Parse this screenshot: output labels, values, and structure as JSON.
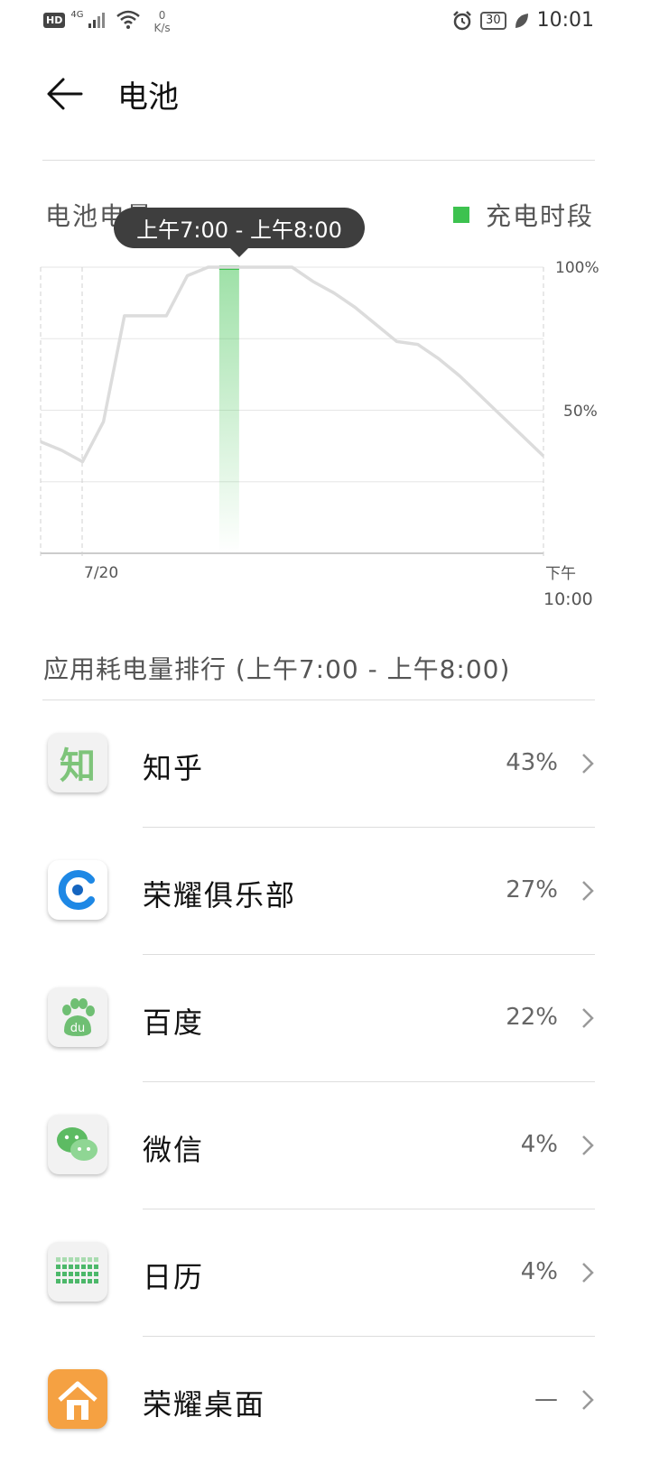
{
  "status_bar": {
    "hd": "HD",
    "network": "4G",
    "speed_value": "0",
    "speed_unit": "K/s",
    "battery": "30",
    "time": "10:01"
  },
  "header": {
    "title": "电池"
  },
  "chart": {
    "label": "电池电量",
    "legend_label": "充电时段",
    "tooltip": "上午7:00 - 上午8:00",
    "date_label": "7/20",
    "end_label_line1": "下午",
    "end_label_line2": "10:00",
    "accent_color": "#3dc24f"
  },
  "chart_data": {
    "type": "line",
    "title": "电池电量",
    "x_start": "7/20",
    "x_end": "下午10:00",
    "ylim": [
      0,
      100
    ],
    "y_ticks": [
      "100%",
      "50%"
    ],
    "highlight": "上午7:00 - 上午8:00",
    "series": [
      {
        "x": [
          0,
          1,
          2,
          3,
          4,
          5,
          6,
          7,
          8,
          9,
          10,
          11,
          12,
          13,
          14,
          15,
          16,
          17,
          18,
          19,
          20,
          21,
          22,
          23,
          24
        ],
        "values": [
          39,
          36,
          32,
          46,
          83,
          83,
          83,
          97,
          100,
          100,
          100,
          100,
          100,
          95,
          91,
          86,
          80,
          74,
          73,
          68,
          62,
          55,
          48,
          41,
          34
        ]
      }
    ]
  },
  "ranking": {
    "title": "应用耗电量排行 (上午7:00 - 上午8:00)",
    "items": [
      {
        "name": "知乎",
        "percent": "43%",
        "icon": "zhihu-icon",
        "icon_text": "知"
      },
      {
        "name": "荣耀俱乐部",
        "percent": "27%",
        "icon": "honor-club-icon",
        "icon_text": ""
      },
      {
        "name": "百度",
        "percent": "22%",
        "icon": "baidu-icon",
        "icon_text": "du"
      },
      {
        "name": "微信",
        "percent": "4%",
        "icon": "wechat-icon",
        "icon_text": ""
      },
      {
        "name": "日历",
        "percent": "4%",
        "icon": "calendar-icon",
        "icon_text": ""
      },
      {
        "name": "荣耀桌面",
        "percent": "—",
        "icon": "honor-home-icon",
        "icon_text": ""
      }
    ]
  }
}
